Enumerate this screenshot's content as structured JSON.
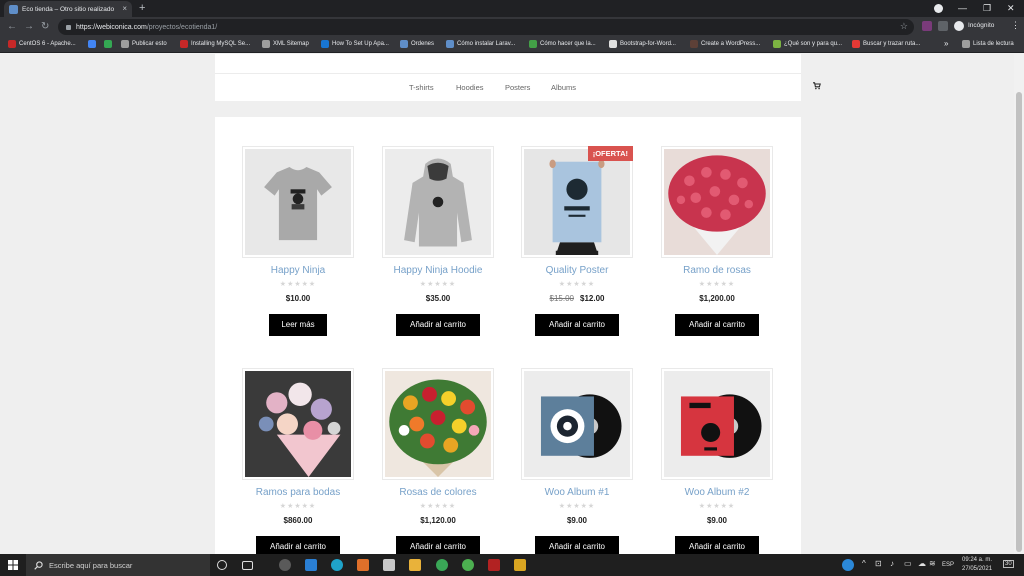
{
  "browser": {
    "tab_title": "Eco tienda – Otro sitio realizado",
    "close_glyph": "×",
    "newtab_glyph": "+",
    "url_host": "https://webiconica.com",
    "url_path": "/proyectos/ecotienda1/",
    "incognito_label": "Incógnito",
    "bookmarks": [
      {
        "label": "CentOS 6 - Apache...",
        "color": "#c62828"
      },
      {
        "label": "",
        "color": "#4285f4"
      },
      {
        "label": "",
        "color": "#34a853"
      },
      {
        "label": "Publicar esto",
        "color": "#9e9e9e"
      },
      {
        "label": "Installing MySQL Se...",
        "color": "#c62828"
      },
      {
        "label": "XML Sitemap",
        "color": "#9e9e9e"
      },
      {
        "label": "How To Set Up Apa...",
        "color": "#1976d2"
      },
      {
        "label": "Ordenes",
        "color": "#5f8ec8"
      },
      {
        "label": "Cómo instalar Larav...",
        "color": "#5f8ec8"
      },
      {
        "label": "Cómo hacer que la...",
        "color": "#43a047"
      },
      {
        "label": "Bootstrap-for-Word...",
        "color": "#e0e0e0"
      },
      {
        "label": "Create a WordPress...",
        "color": "#5d4037"
      },
      {
        "label": "¿Qué son y para qu...",
        "color": "#7cb342"
      },
      {
        "label": "Buscar y trazar ruta...",
        "color": "#e53935"
      },
      {
        "label": "Lista de lectura",
        "color": "#9e9e9e"
      }
    ],
    "bookmarks_more": "»"
  },
  "site": {
    "menu": [
      "T-shirts",
      "Hoodies",
      "Posters",
      "Albums"
    ],
    "products": [
      {
        "name": "Happy Ninja",
        "price": "$10.00",
        "old_price": "",
        "button": "Leer más",
        "image": "tshirt",
        "badge": ""
      },
      {
        "name": "Happy Ninja Hoodie",
        "price": "$35.00",
        "old_price": "",
        "button": "Añadir al carrito",
        "image": "hoodie",
        "badge": ""
      },
      {
        "name": "Quality Poster",
        "price": "$12.00",
        "old_price": "$15.00",
        "button": "Añadir al carrito",
        "image": "poster",
        "badge": "¡OFERTA!"
      },
      {
        "name": "Ramo de rosas",
        "price": "$1,200.00",
        "old_price": "",
        "button": "Añadir al carrito",
        "image": "roses",
        "badge": ""
      },
      {
        "name": "Ramos para bodas",
        "price": "$860.00",
        "old_price": "",
        "button": "Añadir al carrito",
        "image": "bouquet",
        "badge": ""
      },
      {
        "name": "Rosas de colores",
        "price": "$1,120.00",
        "old_price": "",
        "button": "Añadir al carrito",
        "image": "colorful",
        "badge": ""
      },
      {
        "name": "Woo Album #1",
        "price": "$9.00",
        "old_price": "",
        "button": "Añadir al carrito",
        "image": "album-blue",
        "badge": ""
      },
      {
        "name": "Woo Album #2",
        "price": "$9.00",
        "old_price": "",
        "button": "Añadir al carrito",
        "image": "album-red",
        "badge": ""
      }
    ],
    "stars_glyph": "★★★★★"
  },
  "taskbar": {
    "search_placeholder": "Escribe aquí para buscar",
    "lang": "ESP",
    "time": "09:24 a. m.",
    "date": "27/05/2021",
    "notification_count": "30"
  },
  "colors": {
    "link": "#77a1c9",
    "sale_badge": "#d9534f",
    "button_bg": "#000000"
  }
}
